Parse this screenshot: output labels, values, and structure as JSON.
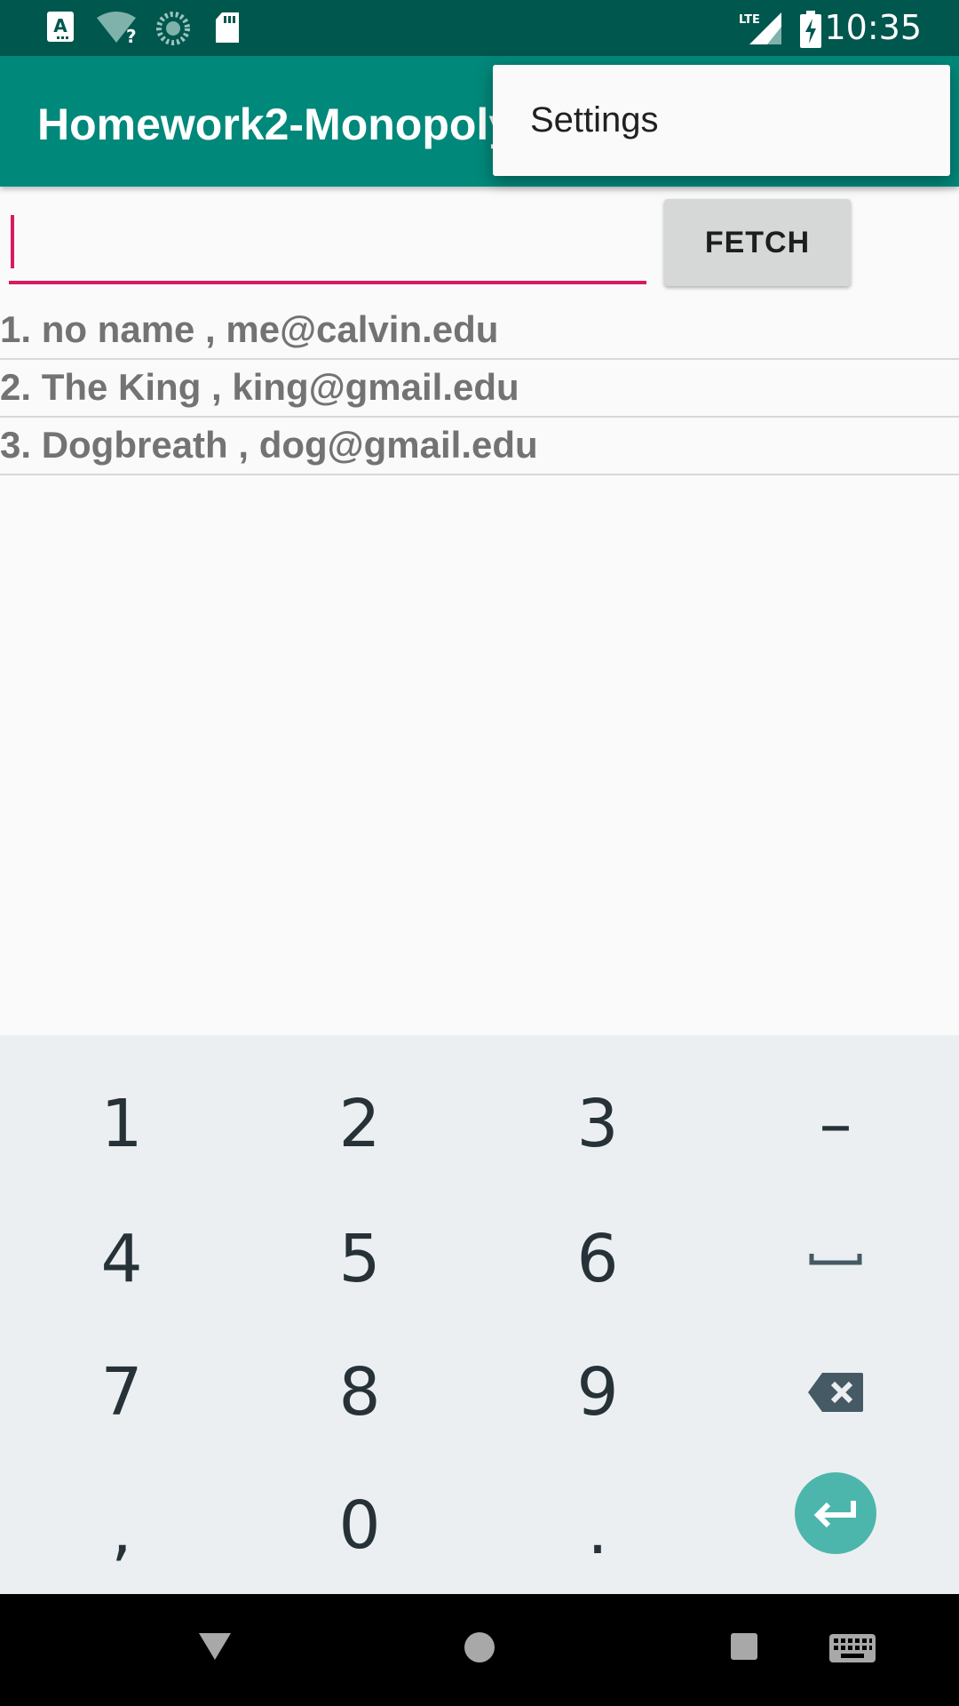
{
  "status_bar": {
    "time": "10:35",
    "network_label": "LTE",
    "icons": [
      "accessibility-a-icon",
      "wifi-unknown-icon",
      "sync-icon",
      "sd-card-icon",
      "lte-signal-icon",
      "battery-charging-icon"
    ]
  },
  "app_bar": {
    "title": "Homework2-Monopoly"
  },
  "overflow_menu": {
    "items": [
      {
        "label": "Settings"
      }
    ]
  },
  "form": {
    "input_value": "",
    "fetch_label": "FETCH"
  },
  "players": [
    {
      "text": "1. no name , me@calvin.edu"
    },
    {
      "text": "2. The King , king@gmail.edu"
    },
    {
      "text": "3. Dogbreath , dog@gmail.edu"
    }
  ],
  "keyboard": {
    "keys": [
      "1",
      "2",
      "3",
      "–",
      "4",
      "5",
      "6",
      "␣",
      "7",
      "8",
      "9",
      "backspace",
      ",",
      "0",
      ".",
      "enter"
    ]
  },
  "nav_bar": {
    "icons": [
      "back-icon",
      "home-icon",
      "recents-icon",
      "keyboard-switch-icon"
    ]
  },
  "colors": {
    "status_bar": "#00574d",
    "app_bar": "#00887a",
    "accent": "#d81b60",
    "enter_key": "#4db6ac"
  }
}
